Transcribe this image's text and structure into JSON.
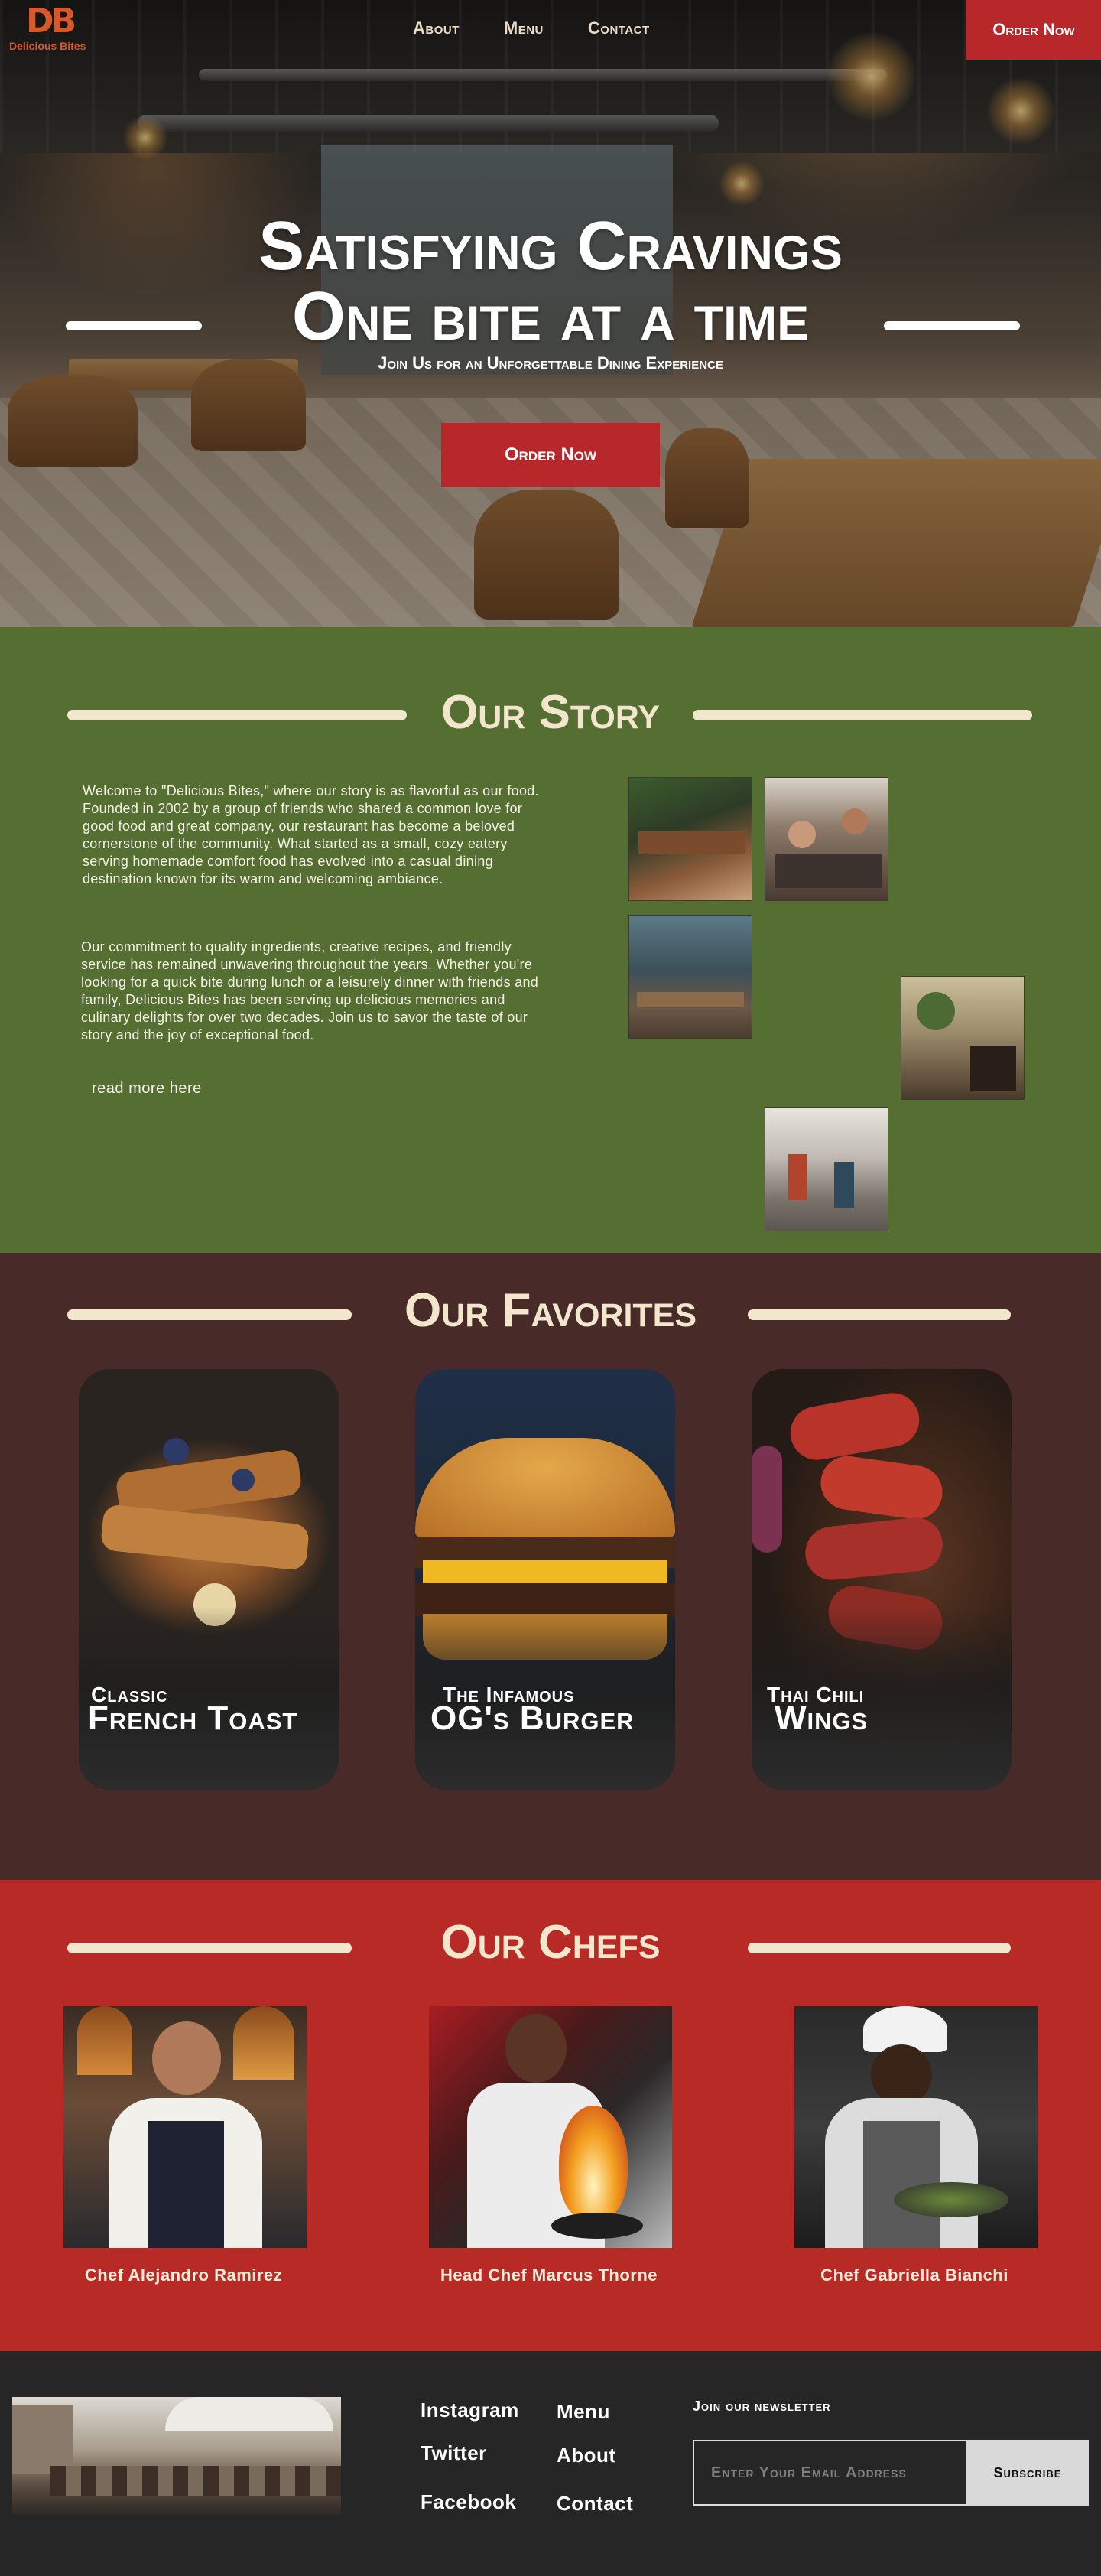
{
  "brand": {
    "logo_mark": "DB",
    "name": "Delicious Bites",
    "accent": "#b8282a",
    "logo_color": "#d9582b"
  },
  "nav": {
    "items": [
      "About",
      "Menu",
      "Contact"
    ],
    "order_label": "Order Now"
  },
  "hero": {
    "line1": "Satisfying Cravings",
    "line2": "One bite at a time",
    "subtitle": "Join Us for an Unforgettable Dining Experience",
    "cta": "Order Now"
  },
  "story": {
    "heading": "Our Story",
    "p1": "Welcome to \"Delicious Bites,\" where our story is as flavorful as our food. Founded in 2002 by a group of friends who shared a common love for good food and great company, our restaurant has become a beloved cornerstone of the community. What started as a small, cozy eatery serving homemade comfort food has evolved into a casual dining destination known for its warm and welcoming ambiance.",
    "p2": "Our commitment to quality ingredients, creative recipes, and friendly service has remained unwavering throughout the years. Whether you're looking for a quick bite during lunch or a leisurely dinner with friends and family, Delicious Bites has been serving up delicious memories and culinary delights for over two decades. Join us to savor the taste of our story and the joy of exceptional food.",
    "read_more": "read more here",
    "background": "#546f31"
  },
  "favorites": {
    "heading": "Our Favorites",
    "items": [
      {
        "small": "Classic",
        "big": "French Toast"
      },
      {
        "small": "The Infamous",
        "big": "OG's Burger"
      },
      {
        "small": "Thai Chili",
        "big": "Wings"
      }
    ],
    "background": "#482a29"
  },
  "chefs": {
    "heading": "Our Chefs",
    "items": [
      {
        "name": "Chef Alejandro Ramirez"
      },
      {
        "name": "Head Chef Marcus Thorne"
      },
      {
        "name": "Chef Gabriella Bianchi"
      }
    ],
    "background": "#b72a26"
  },
  "footer": {
    "social": [
      "Instagram",
      "Twitter",
      "Facebook"
    ],
    "links": [
      "Menu",
      "About",
      "Contact"
    ],
    "newsletter_label": "Join our newsletter",
    "email_placeholder": "Enter Your Email Address",
    "subscribe": "Subscribe"
  }
}
